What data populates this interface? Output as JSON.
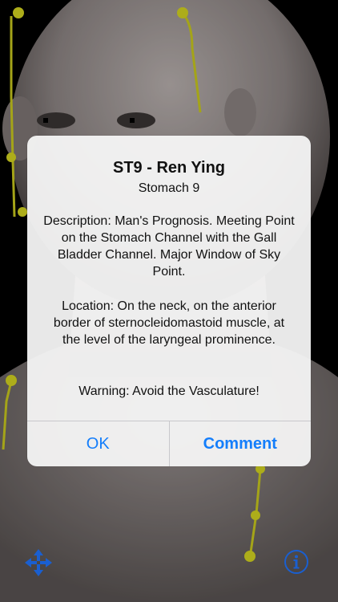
{
  "alert": {
    "title": "ST9 - Ren Ying",
    "subtitle": "Stomach 9",
    "description": "Description: Man's Prognosis. Meeting Point on the Stomach Channel with the Gall Bladder Channel. Major Window of Sky Point.",
    "location": "Location: On the neck, on the anterior border of sternocleidomastoid muscle, at the level of the laryngeal prominence.",
    "warning": "Warning: Avoid the Vasculature!",
    "buttons": {
      "ok": "OK",
      "comment": "Comment"
    }
  },
  "colors": {
    "accent": "#147efb",
    "point": "#d4d420",
    "channel": "#c8c81e"
  },
  "icons": {
    "move": "move-arrows-icon",
    "info": "info-icon"
  }
}
